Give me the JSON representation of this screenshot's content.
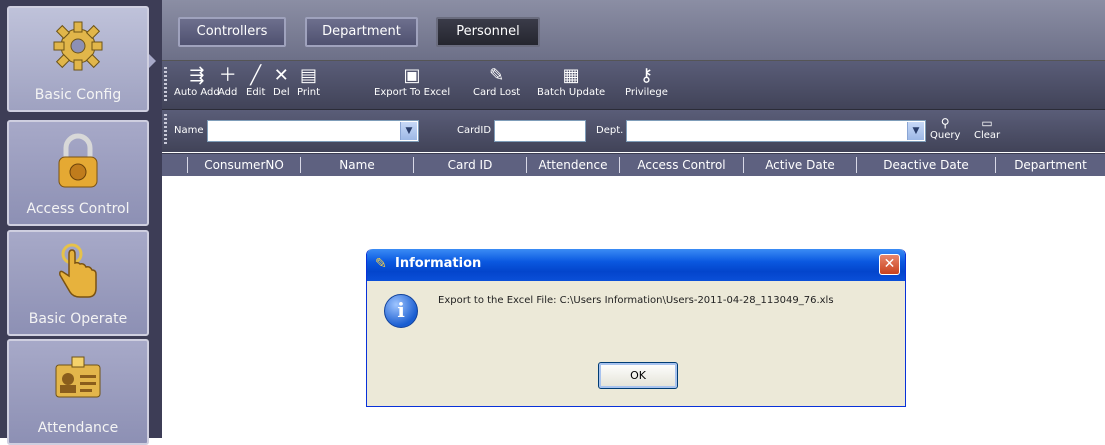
{
  "nav": [
    {
      "label": "Basic Config",
      "icon": "gear-icon"
    },
    {
      "label": "Access Control",
      "icon": "padlock-icon"
    },
    {
      "label": "Basic Operate",
      "icon": "hand-pointer-icon"
    },
    {
      "label": "Attendance",
      "icon": "id-card-icon"
    }
  ],
  "tabs": [
    "Controllers",
    "Department",
    "Personnel"
  ],
  "toolbar": [
    {
      "label": "Auto Add",
      "icon": "auto-add-icon"
    },
    {
      "label": "Add",
      "icon": "plus-icon"
    },
    {
      "label": "Edit",
      "icon": "pencil-icon"
    },
    {
      "label": "Del",
      "icon": "x-icon"
    },
    {
      "label": "Print",
      "icon": "printer-icon"
    },
    {
      "label": "Export To Excel",
      "icon": "excel-icon"
    },
    {
      "label": "Card Lost",
      "icon": "card-lost-icon"
    },
    {
      "label": "Batch Update",
      "icon": "batch-update-icon"
    },
    {
      "label": "Privilege",
      "icon": "key-icon"
    }
  ],
  "filters": {
    "name_label": "Name",
    "name_value": "",
    "cardid_label": "CardID",
    "cardid_value": "",
    "dept_label": "Dept.",
    "dept_value": "",
    "query_label": "Query",
    "clear_label": "Clear"
  },
  "columns": [
    "ConsumerNO",
    "Name",
    "Card ID",
    "Attendence",
    "Access Control",
    "Active Date",
    "Deactive Date",
    "Department"
  ],
  "dialog": {
    "title": "Information",
    "message": "Export to the Excel File: C:\\Users Information\\Users-2011-04-28_113049_76.xls",
    "ok_label": "OK",
    "close_glyph": "✕"
  },
  "colors": {
    "nav_bg": "#3d3d56",
    "title_bar": "#0a58e0"
  }
}
